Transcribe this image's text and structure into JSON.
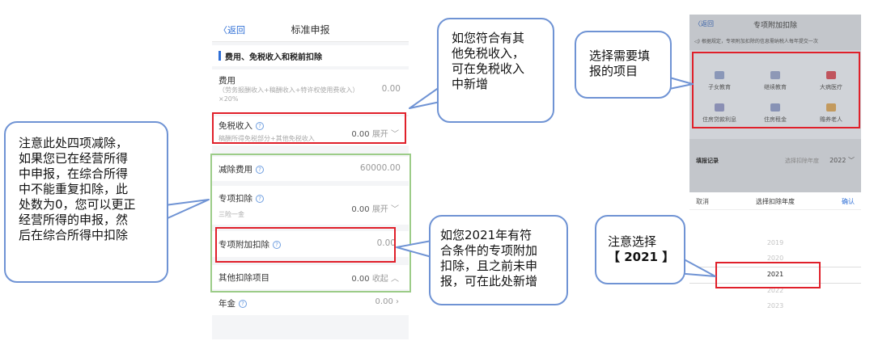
{
  "screen1": {
    "nav": {
      "back": "〈返回",
      "title": "标准申报"
    },
    "section_title": "费用、免税收入和税前扣除",
    "rows": [
      {
        "label": "费用",
        "sub1": "（劳务报酬收入+稿酬收入+特许权使用费收入）",
        "sub2": "×20%",
        "value": "0.00"
      },
      {
        "label": "免税收入",
        "sub": "稿酬所得免税部分+其他免税收入",
        "value": "0.00",
        "action": "展开"
      },
      {
        "label": "减除费用",
        "value": "60000.00"
      },
      {
        "label": "专项扣除",
        "sub": "三险一金",
        "value": "0.00",
        "action": "展开"
      },
      {
        "label": "专项附加扣除",
        "value": "0.00"
      },
      {
        "label": "其他扣除项目",
        "value": "0.00",
        "action": "收起"
      },
      {
        "label": "年金",
        "value": "0.00"
      }
    ],
    "help_glyph": "?"
  },
  "screen2": {
    "nav": {
      "back": "〈返回",
      "title": "专项附加扣除"
    },
    "notice": "根据规定，专项附加扣除的信息需纳税人每年提交一次",
    "items": [
      {
        "label": "子女教育",
        "color": "#8a97b8"
      },
      {
        "label": "继续教育",
        "color": "#8e98b6"
      },
      {
        "label": "大病医疗",
        "color": "#c0545d"
      },
      {
        "label": "住房贷款利息",
        "color": "#8a8fb4"
      },
      {
        "label": "住房租金",
        "color": "#8792b5"
      },
      {
        "label": "赡养老人",
        "color": "#c39a5e"
      }
    ],
    "record": {
      "label": "填报记录",
      "year_label": "选择扣除年度",
      "year": "2022"
    },
    "picker": {
      "cancel": "取消",
      "title": "选择扣除年度",
      "confirm": "确认",
      "years": [
        "2019",
        "2020",
        "2021",
        "2022",
        "2023"
      ],
      "selected": "2021"
    }
  },
  "callouts": {
    "left": [
      "注意此处四项减除，",
      "如果您已在经营所得",
      "中申报，在综合所得",
      "中不能重复扣除，此",
      "处数为0，您可以更正",
      "经营所得的申报，然",
      "后在综合所得中扣除"
    ],
    "top_middle": [
      "如您符合有其",
      "他免税收入，",
      "可在免税收入",
      "中新增"
    ],
    "bottom_middle": [
      "如您2021年有符",
      "合条件的专项附加",
      "扣除，且之前未申",
      "报，可在此处新增"
    ],
    "top_right": [
      "选择需要填",
      "报的项目"
    ],
    "bottom_right": [
      "注意选择",
      "【 2021 】"
    ]
  },
  "colors": {
    "highlight_red": "#e0202a",
    "highlight_green": "#9ccc88",
    "callout_border": "#6f93d4",
    "accent_blue": "#2f6fd6"
  }
}
